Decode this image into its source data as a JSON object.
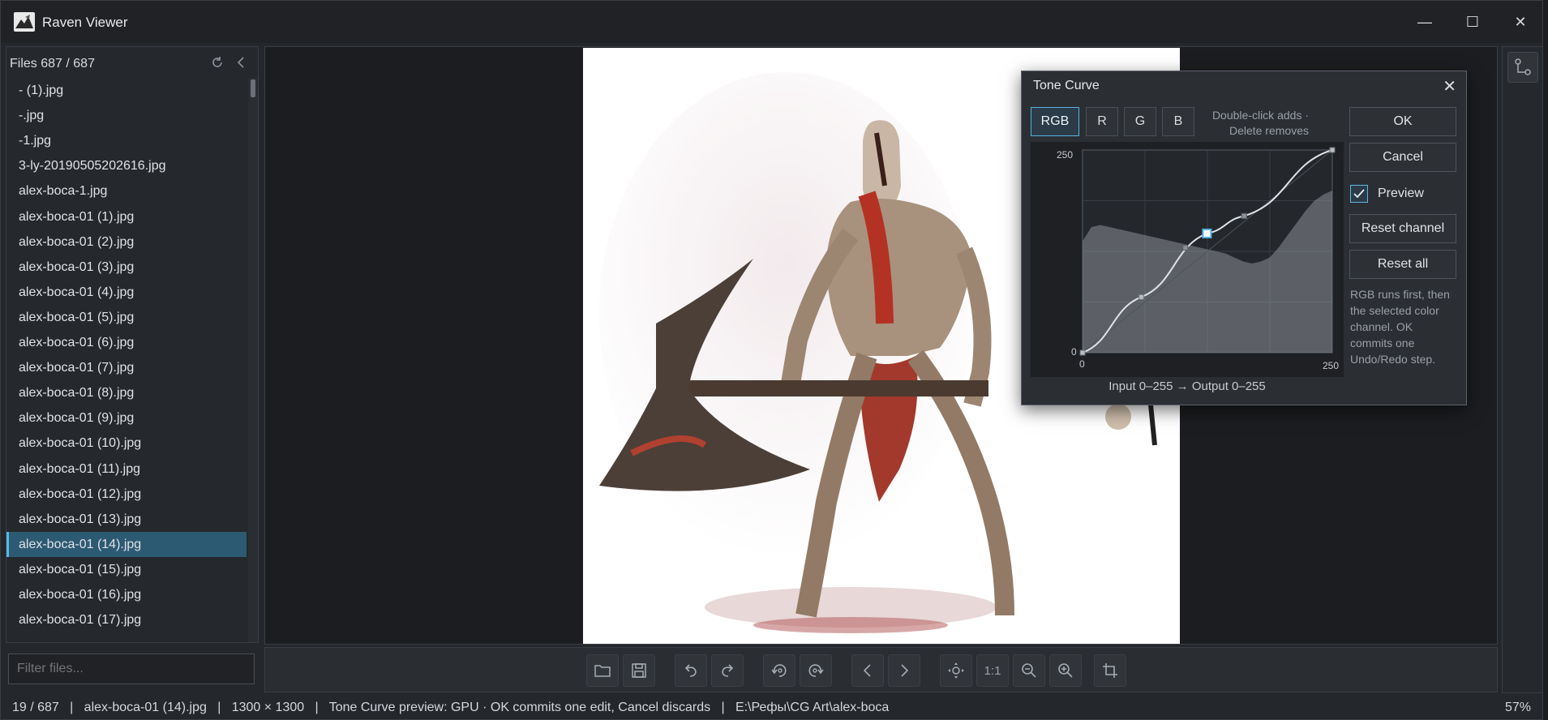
{
  "app": {
    "title": "Raven Viewer"
  },
  "window_controls": {
    "minimize": "—",
    "maximize": "☐",
    "close": "✕"
  },
  "sidebar": {
    "title": "Files",
    "count": "687 / 687",
    "selected_index": 18,
    "files": [
      "- (1).jpg",
      "-.jpg",
      "-1.jpg",
      "3-ly-20190505202616.jpg",
      "alex-boca-1.jpg",
      "alex-boca-01 (1).jpg",
      "alex-boca-01 (2).jpg",
      "alex-boca-01 (3).jpg",
      "alex-boca-01 (4).jpg",
      "alex-boca-01 (5).jpg",
      "alex-boca-01 (6).jpg",
      "alex-boca-01 (7).jpg",
      "alex-boca-01 (8).jpg",
      "alex-boca-01 (9).jpg",
      "alex-boca-01 (10).jpg",
      "alex-boca-01 (11).jpg",
      "alex-boca-01 (12).jpg",
      "alex-boca-01 (13).jpg",
      "alex-boca-01 (14).jpg",
      "alex-boca-01 (15).jpg",
      "alex-boca-01 (16).jpg",
      "alex-boca-01 (17).jpg"
    ],
    "filter_placeholder": "Filter files..."
  },
  "toolbar": {
    "buttons": [
      {
        "name": "open-folder-button",
        "icon": "folder-icon"
      },
      {
        "name": "save-button",
        "icon": "save-icon"
      },
      {
        "name": "undo-button",
        "icon": "undo-icon"
      },
      {
        "name": "redo-button",
        "icon": "redo-icon"
      },
      {
        "name": "rotate-left-button",
        "icon": "rotate-left-icon"
      },
      {
        "name": "rotate-right-button",
        "icon": "rotate-right-icon"
      },
      {
        "name": "previous-button",
        "icon": "chevron-left-icon"
      },
      {
        "name": "next-button",
        "icon": "chevron-right-icon"
      },
      {
        "name": "fit-button",
        "icon": "fit-icon"
      },
      {
        "name": "actual-size-button",
        "label": "1:1"
      },
      {
        "name": "zoom-out-button",
        "icon": "zoom-out-icon"
      },
      {
        "name": "zoom-in-button",
        "icon": "zoom-in-icon"
      },
      {
        "name": "crop-button",
        "icon": "crop-icon"
      }
    ]
  },
  "status": {
    "position": "19 / 687",
    "filename": "alex-boca-01 (14).jpg",
    "dimensions": "1300 × 1300",
    "message": "Tone Curve preview: GPU · OK commits one edit, Cancel discards",
    "path": "E:\\Рефы\\CG Art\\alex-boca",
    "zoom": "57%",
    "separator": "|"
  },
  "tone_curve": {
    "title": "Tone Curve",
    "close": "✕",
    "channels": [
      "RGB",
      "R",
      "G",
      "B"
    ],
    "active_channel": "RGB",
    "hint": "Double-click adds · Delete removes",
    "axis": {
      "y_max": "250",
      "y_min": "0",
      "x_min": "0",
      "x_max": "250"
    },
    "io_label": "Input 0–255  →  Output 0–255",
    "ok": "OK",
    "cancel": "Cancel",
    "preview_label": "Preview",
    "preview_checked": true,
    "reset_channel": "Reset channel",
    "reset_all": "Reset all",
    "note": "RGB runs first, then the selected color channel. OK commits one Undo/Redo step.",
    "curve_points": [
      [
        0,
        0
      ],
      [
        60,
        70
      ],
      [
        127,
        150
      ],
      [
        165,
        172
      ],
      [
        255,
        255
      ]
    ],
    "ghost_points": [
      [
        105,
        132
      ],
      [
        165,
        172
      ]
    ],
    "selected_point": [
      127,
      150
    ],
    "accent": "#57b3e3"
  }
}
